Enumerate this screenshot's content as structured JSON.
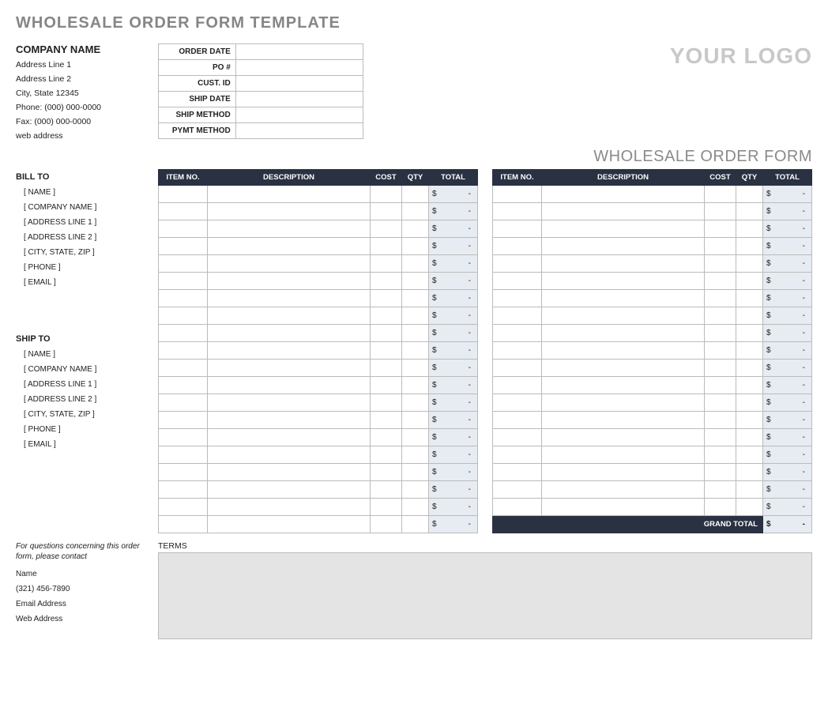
{
  "page_title": "WHOLESALE ORDER FORM TEMPLATE",
  "company": {
    "name": "COMPANY NAME",
    "address1": "Address Line 1",
    "address2": "Address Line 2",
    "city_state_zip": "City, State  12345",
    "phone": "Phone: (000) 000-0000",
    "fax": "Fax: (000) 000-0000",
    "web": "web address"
  },
  "meta_labels": {
    "order_date": "ORDER DATE",
    "po": "PO #",
    "cust_id": "CUST. ID",
    "ship_date": "SHIP DATE",
    "ship_method": "SHIP METHOD",
    "pymt_method": "PYMT METHOD"
  },
  "meta_values": {
    "order_date": "",
    "po": "",
    "cust_id": "",
    "ship_date": "",
    "ship_method": "",
    "pymt_method": ""
  },
  "logo_text": "YOUR LOGO",
  "form_type": "WHOLESALE ORDER FORM",
  "bill_to": {
    "heading": "BILL TO",
    "fields": [
      "[ NAME ]",
      "[ COMPANY NAME ]",
      "[ ADDRESS LINE 1 ]",
      "[ ADDRESS LINE 2 ]",
      "[ CITY, STATE, ZIP ]",
      "[ PHONE ]",
      "[ EMAIL ]"
    ]
  },
  "ship_to": {
    "heading": "SHIP TO",
    "fields": [
      "[ NAME ]",
      "[ COMPANY NAME ]",
      "[ ADDRESS LINE 1 ]",
      "[ ADDRESS LINE 2 ]",
      "[ CITY, STATE, ZIP ]",
      "[ PHONE ]",
      "[ EMAIL ]"
    ]
  },
  "item_headers": {
    "item_no": "ITEM NO.",
    "description": "DESCRIPTION",
    "cost": "COST",
    "qty": "QTY",
    "total": "TOTAL"
  },
  "row_total_placeholder": {
    "currency": "$",
    "dash": "-"
  },
  "left_row_count": 20,
  "right_row_count": 19,
  "grand_total": {
    "label": "GRAND TOTAL",
    "currency": "$",
    "value": "-"
  },
  "questions_note": "For questions concerning this order form, please contact",
  "contact": {
    "name": "Name",
    "phone": "(321) 456-7890",
    "email": "Email Address",
    "web": "Web Address"
  },
  "terms_label": "TERMS",
  "terms_value": ""
}
